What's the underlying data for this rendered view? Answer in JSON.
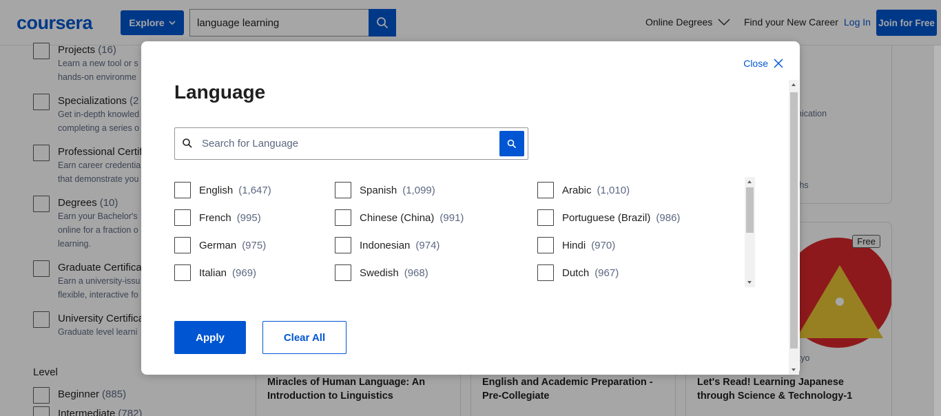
{
  "header": {
    "logo": "coursera",
    "explore_label": "Explore",
    "search_value": "language learning",
    "nav": {
      "degrees": "Online Degrees",
      "career": "Find your New Career",
      "login": "Log In",
      "join": "Join for Free"
    }
  },
  "sidebar": {
    "items": [
      {
        "title": "Projects",
        "count": "(16)",
        "desc": "Learn a new tool or s\nhands-on environme"
      },
      {
        "title": "Specializations",
        "count": "(2",
        "desc": "Get in-depth knowled\ncompleting a series o"
      },
      {
        "title": "Professional Certif",
        "count": "",
        "desc": "Earn career credentia\nthat demonstrate you"
      },
      {
        "title": "Degrees",
        "count": "(10)",
        "desc": "Earn your Bachelor's\nonline for a fraction o\nlearning."
      },
      {
        "title": "Graduate Certifica",
        "count": "",
        "desc": "Earn a university-issu\nflexible, interactive fo"
      },
      {
        "title": "University Certifica",
        "count": "",
        "desc": "Graduate level learni"
      }
    ],
    "level_heading": "Level",
    "levels": [
      {
        "title": "Beginner",
        "count": "(885)"
      },
      {
        "title": "Intermediate",
        "count": "(782)"
      }
    ]
  },
  "cards": {
    "top_right_fragment_1": "nication",
    "top_right_fragment_2": "ths",
    "card1_title": "Miracles of Human Language: An Introduction to Linguistics",
    "card2_title": "English and Academic Preparation - Pre-Collegiate",
    "card3_title": "Let's Read! Learning Japanese through Science & Technology-1",
    "card3_partner": "kyo",
    "card3_badge": "Free"
  },
  "modal": {
    "close_label": "Close",
    "title": "Language",
    "search_placeholder": "Search for Language",
    "languages": [
      {
        "name": "English",
        "count": "(1,647)"
      },
      {
        "name": "Spanish",
        "count": "(1,099)"
      },
      {
        "name": "Arabic",
        "count": "(1,010)"
      },
      {
        "name": "French",
        "count": "(995)"
      },
      {
        "name": "Chinese (China)",
        "count": "(991)"
      },
      {
        "name": "Portuguese (Brazil)",
        "count": "(986)"
      },
      {
        "name": "German",
        "count": "(975)"
      },
      {
        "name": "Indonesian",
        "count": "(974)"
      },
      {
        "name": "Hindi",
        "count": "(970)"
      },
      {
        "name": "Italian",
        "count": "(969)"
      },
      {
        "name": "Swedish",
        "count": "(968)"
      },
      {
        "name": "Dutch",
        "count": "(967)"
      }
    ],
    "apply_label": "Apply",
    "clear_label": "Clear All"
  },
  "colors": {
    "brand": "#0056d2",
    "overlay": "rgba(0,0,0,0.35)",
    "muted_text": "#5b6780"
  },
  "icons": [
    "chevron-down-icon",
    "search-icon",
    "close-icon",
    "checkbox-icon"
  ]
}
